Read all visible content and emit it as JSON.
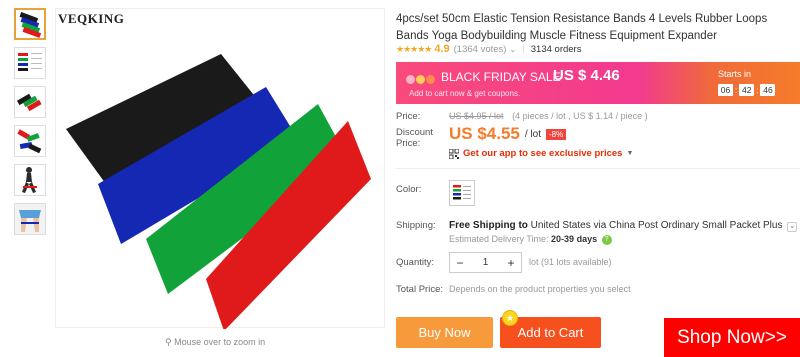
{
  "brand": "VEQKING",
  "zoom_hint": "Mouse over to zoom in",
  "product": {
    "title": "4pcs/set 50cm Elastic Tension Resistance Bands 4 Levels Rubber Loops Bands Yoga Bodybuilding Muscle Fitness Equipment Expander",
    "stars": "★★★★★",
    "rating": "4.9",
    "votes": "(1364 votes)",
    "orders": "3134 orders"
  },
  "banner": {
    "label": "BLACK FRIDAY SALE",
    "price": "US $ 4.46",
    "sub": "Add to cart now & get coupons.",
    "starts_in": "Starts in",
    "timer": [
      "06",
      "42",
      "46"
    ]
  },
  "pricing": {
    "price_label": "Price:",
    "old_price": "US $4.95 / lot",
    "old_detail": "(4 pieces / lot , US $ 1.14 / piece )",
    "discount_label": "Discount Price:",
    "discount_price": "US $4.55",
    "per_lot": "/ lot",
    "discount_badge": "-8%",
    "app_text": "Get our app to see exclusive prices"
  },
  "options": {
    "color_label": "Color:",
    "shipping_label": "Shipping:",
    "shipping_free": "Free Shipping to",
    "shipping_dest": "United States via China Post Ordinary Small Packet Plus",
    "est_label": "Estimated Delivery Time:",
    "est_value": "20-39",
    "est_unit": "days",
    "quantity_label": "Quantity:",
    "quantity_value": "1",
    "lot_note": "lot (91 lots available)",
    "total_label": "Total Price:",
    "total_note": "Depends on the product properties you select"
  },
  "buttons": {
    "buy_now": "Buy Now",
    "add_to_cart": "Add to Cart",
    "shop_now": "Shop Now>>"
  },
  "colors": {
    "accent_orange": "#f57c2a",
    "buy_now": "#f79a3c",
    "add_to_cart": "#f5501e",
    "shop_now": "#ff0000",
    "band_colors": [
      "#1a1a1a",
      "#1428b4",
      "#12a23a",
      "#e01a1a"
    ]
  }
}
